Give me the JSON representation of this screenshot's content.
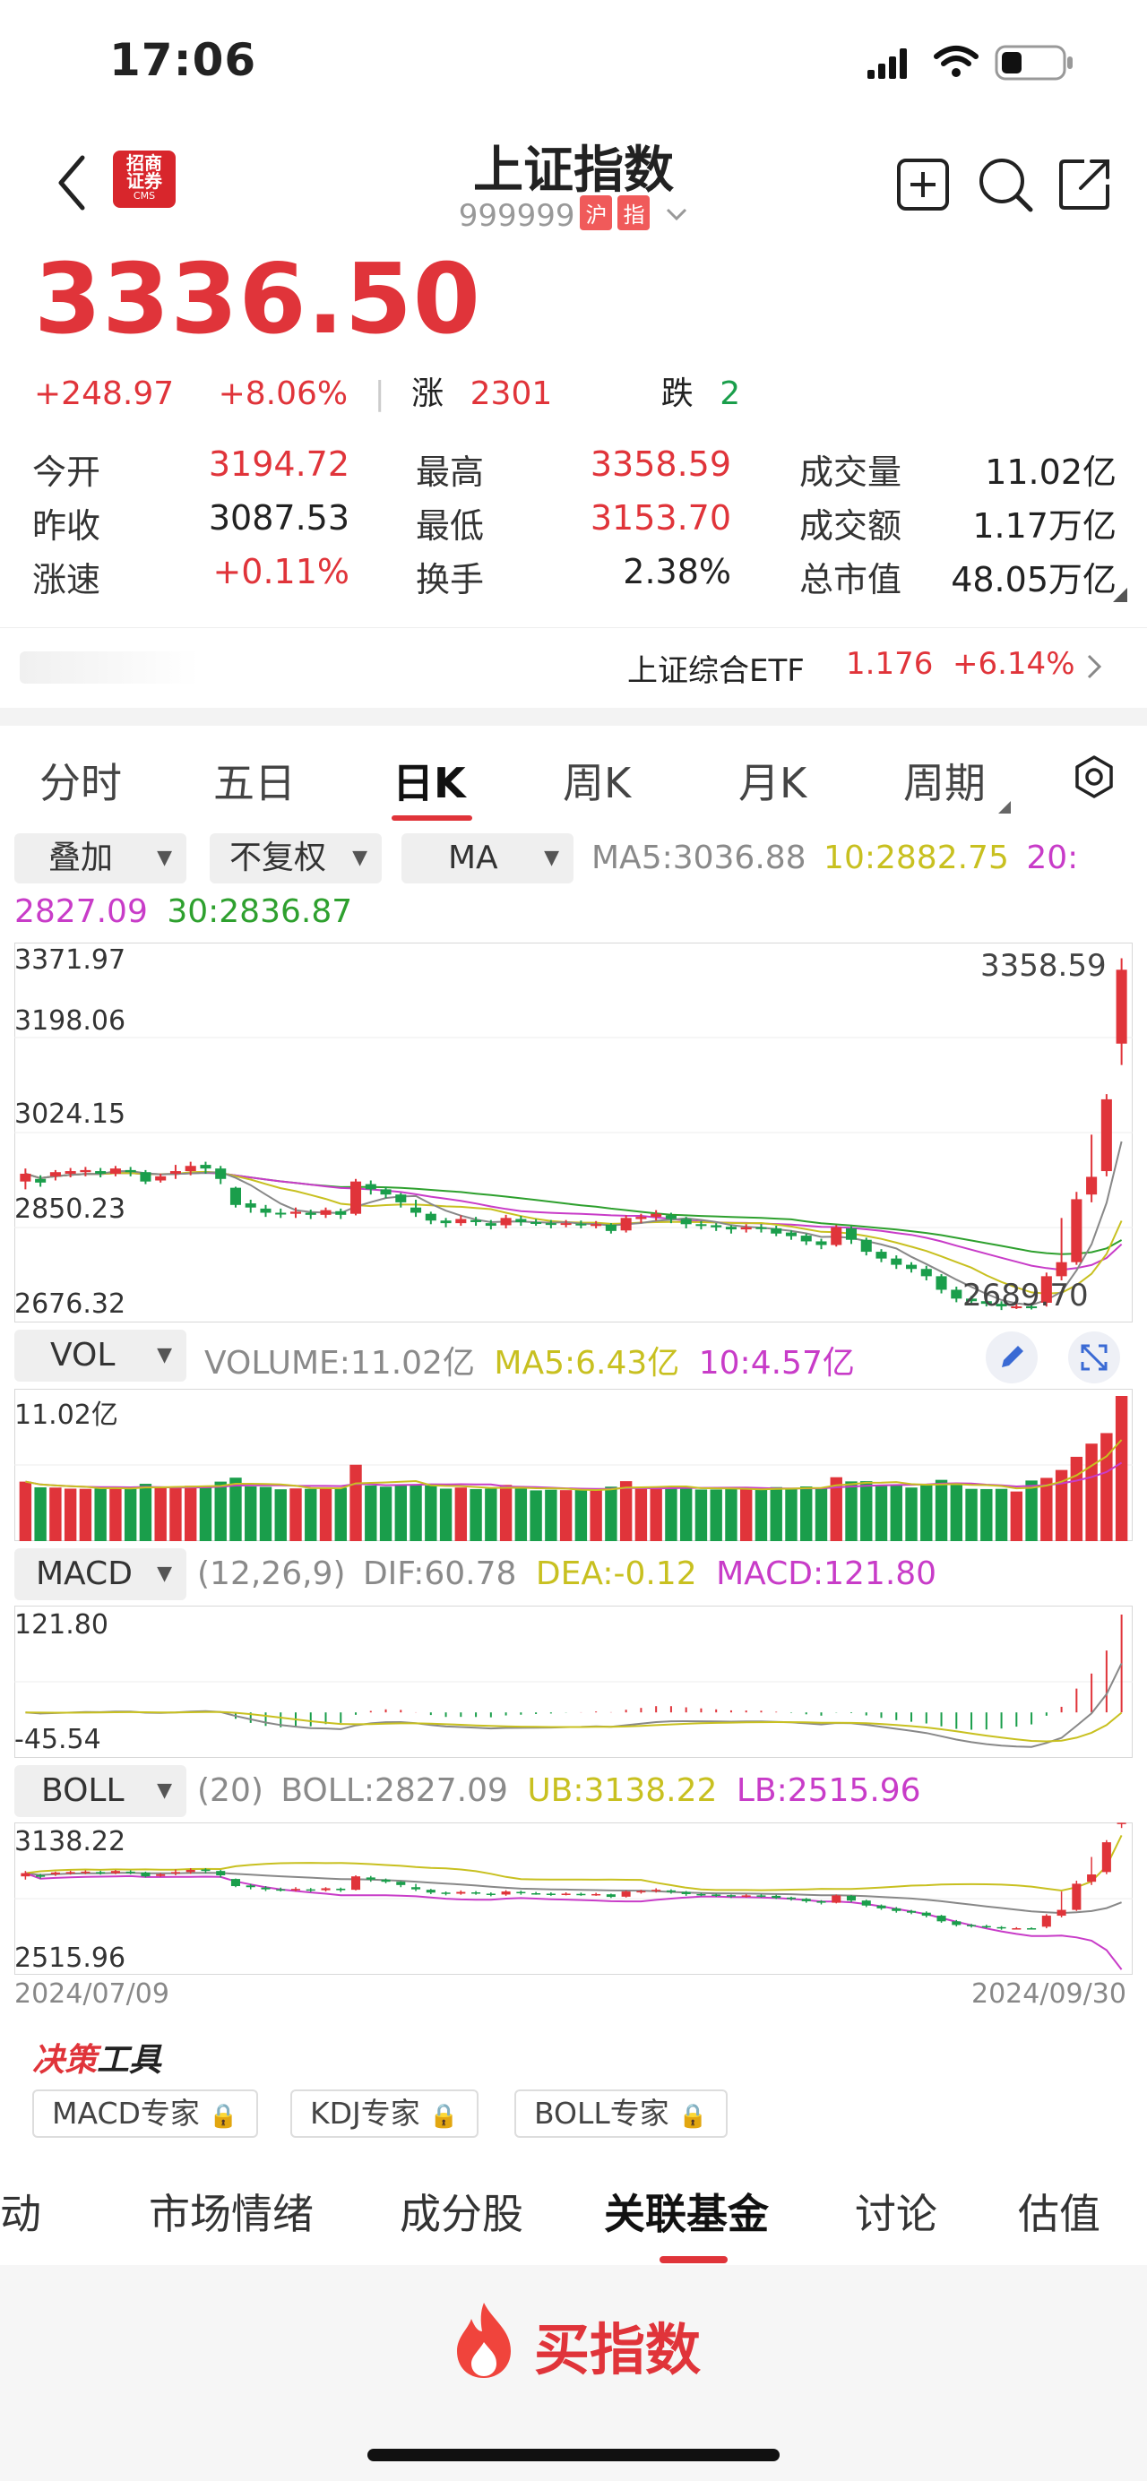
{
  "status_bar": {
    "time": "17:06"
  },
  "header": {
    "title": "上证指数",
    "code": "999999",
    "tags": [
      "沪",
      "指"
    ],
    "logo_text": [
      "招商",
      "证券",
      "CMS"
    ]
  },
  "quote": {
    "price": "3336.50",
    "change": "+248.97",
    "change_pct": "+8.06%",
    "up_label": "涨",
    "up_count": "2301",
    "down_label": "跌",
    "down_count": "2"
  },
  "stats": [
    [
      {
        "label": "今开",
        "value": "3194.72"
      },
      {
        "label": "最高",
        "value": "3358.59"
      },
      {
        "label": "成交量",
        "value": "11.02亿"
      }
    ],
    [
      {
        "label": "昨收",
        "value": "3087.53"
      },
      {
        "label": "最低",
        "value": "3153.70"
      },
      {
        "label": "成交额",
        "value": "1.17万亿"
      }
    ],
    [
      {
        "label": "涨速",
        "value": "+0.11%"
      },
      {
        "label": "换手",
        "value": "2.38%"
      },
      {
        "label": "总市值",
        "value": "48.05万亿"
      }
    ]
  ],
  "etf": {
    "name": "上证综合ETF",
    "price": "1.176",
    "pct": "+6.14%"
  },
  "period_tabs": [
    "分时",
    "五日",
    "日K",
    "周K",
    "月K",
    "周期"
  ],
  "selectors": {
    "overlay": "叠加",
    "adjust": "不复权",
    "indicator": "MA"
  },
  "ma_legend": {
    "ma5": "MA5:3036.88",
    "ma10": "10:2882.75",
    "ma20_a": "20:",
    "ma20_b": "2827.09",
    "ma30": "30:2836.87"
  },
  "kline_axis": [
    "3371.97",
    "3198.06",
    "3024.15",
    "2850.23",
    "2676.32"
  ],
  "kline_marks": {
    "high": "3358.59",
    "low": "2689.70"
  },
  "vol": {
    "selector": "VOL",
    "volume": "VOLUME:11.02亿",
    "ma5": "MA5:6.43亿",
    "ma10": "10:4.57亿",
    "axis_max": "11.02亿"
  },
  "macd": {
    "selector": "MACD",
    "params": "(12,26,9)",
    "dif": "DIF:60.78",
    "dea": "DEA:-0.12",
    "macd": "MACD:121.80",
    "axis_max": "121.80",
    "axis_min": "-45.54"
  },
  "boll": {
    "selector": "BOLL",
    "params": "(20)",
    "boll": "BOLL:2827.09",
    "ub": "UB:3138.22",
    "lb": "LB:2515.96",
    "axis_max": "3138.22",
    "axis_min": "2515.96"
  },
  "dates": {
    "start": "2024/07/09",
    "end": "2024/09/30"
  },
  "decision": {
    "title_a": "决策",
    "title_b": "工具",
    "tools": [
      "MACD专家",
      "KDJ专家",
      "BOLL专家"
    ]
  },
  "bottom_tabs": [
    "异动",
    "市场情绪",
    "成分股",
    "关联基金",
    "讨论",
    "估值"
  ],
  "buy": {
    "label": "买指数"
  },
  "colors": {
    "up": "#e0343a",
    "down": "#1a9e4b",
    "ma5": "#888888",
    "ma10": "#c8c020",
    "ma20": "#c83cc8",
    "ma30": "#2ea02e"
  },
  "chart_data": {
    "type": "candlestick",
    "x_start": "2024/07/09",
    "x_end": "2024/09/30",
    "ylim": [
      2676.32,
      3371.97
    ],
    "candles": [
      [
        2930,
        2945,
        2915,
        2955
      ],
      [
        2935,
        2928,
        2920,
        2942
      ],
      [
        2940,
        2948,
        2932,
        2952
      ],
      [
        2945,
        2950,
        2938,
        2956
      ],
      [
        2948,
        2952,
        2940,
        2958
      ],
      [
        2950,
        2945,
        2938,
        2956
      ],
      [
        2945,
        2955,
        2940,
        2960
      ],
      [
        2952,
        2948,
        2940,
        2958
      ],
      [
        2948,
        2930,
        2925,
        2952
      ],
      [
        2932,
        2940,
        2928,
        2945
      ],
      [
        2945,
        2950,
        2935,
        2962
      ],
      [
        2950,
        2960,
        2942,
        2968
      ],
      [
        2962,
        2955,
        2945,
        2968
      ],
      [
        2955,
        2935,
        2925,
        2960
      ],
      [
        2918,
        2885,
        2880,
        2920
      ],
      [
        2888,
        2880,
        2870,
        2895
      ],
      [
        2878,
        2870,
        2862,
        2885
      ],
      [
        2870,
        2868,
        2860,
        2878
      ],
      [
        2868,
        2872,
        2860,
        2880
      ],
      [
        2870,
        2866,
        2858,
        2876
      ],
      [
        2866,
        2875,
        2860,
        2880
      ],
      [
        2873,
        2866,
        2858,
        2878
      ],
      [
        2868,
        2930,
        2865,
        2935
      ],
      [
        2925,
        2915,
        2905,
        2932
      ],
      [
        2915,
        2905,
        2898,
        2920
      ],
      [
        2905,
        2890,
        2880,
        2908
      ],
      [
        2880,
        2870,
        2862,
        2895
      ],
      [
        2868,
        2855,
        2848,
        2872
      ],
      [
        2855,
        2850,
        2842,
        2860
      ],
      [
        2850,
        2858,
        2845,
        2865
      ],
      [
        2856,
        2852,
        2845,
        2862
      ],
      [
        2850,
        2845,
        2838,
        2856
      ],
      [
        2846,
        2860,
        2840,
        2866
      ],
      [
        2858,
        2852,
        2845,
        2864
      ],
      [
        2852,
        2850,
        2845,
        2858
      ],
      [
        2850,
        2848,
        2840,
        2856
      ],
      [
        2848,
        2850,
        2842,
        2856
      ],
      [
        2849,
        2846,
        2840,
        2855
      ],
      [
        2846,
        2848,
        2840,
        2854
      ],
      [
        2847,
        2835,
        2830,
        2850
      ],
      [
        2836,
        2860,
        2832,
        2865
      ],
      [
        2858,
        2862,
        2850,
        2868
      ],
      [
        2862,
        2868,
        2855,
        2875
      ],
      [
        2865,
        2858,
        2850,
        2870
      ],
      [
        2858,
        2848,
        2840,
        2862
      ],
      [
        2848,
        2845,
        2838,
        2854
      ],
      [
        2846,
        2842,
        2835,
        2850
      ],
      [
        2843,
        2838,
        2830,
        2846
      ],
      [
        2838,
        2842,
        2832,
        2848
      ],
      [
        2842,
        2840,
        2832,
        2848
      ],
      [
        2840,
        2830,
        2825,
        2845
      ],
      [
        2832,
        2825,
        2818,
        2836
      ],
      [
        2826,
        2815,
        2808,
        2830
      ],
      [
        2815,
        2808,
        2800,
        2820
      ],
      [
        2808,
        2842,
        2805,
        2846
      ],
      [
        2840,
        2818,
        2810,
        2844
      ],
      [
        2818,
        2795,
        2788,
        2822
      ],
      [
        2795,
        2782,
        2775,
        2800
      ],
      [
        2782,
        2770,
        2762,
        2788
      ],
      [
        2770,
        2762,
        2755,
        2775
      ],
      [
        2762,
        2748,
        2740,
        2768
      ],
      [
        2748,
        2722,
        2715,
        2752
      ],
      [
        2722,
        2705,
        2698,
        2728
      ],
      [
        2705,
        2700,
        2693,
        2710
      ],
      [
        2700,
        2695,
        2690,
        2706
      ],
      [
        2695,
        2690,
        2683,
        2700
      ],
      [
        2690,
        2690,
        2685,
        2695
      ],
      [
        2690,
        2688,
        2684,
        2694
      ],
      [
        2697,
        2748,
        2689.7,
        2755
      ],
      [
        2748,
        2775,
        2740,
        2860
      ],
      [
        2775,
        2896,
        2770,
        2910
      ],
      [
        2905,
        2939,
        2890,
        3020
      ],
      [
        2950,
        3088,
        2940,
        3098
      ],
      [
        3195,
        3337,
        3154,
        3359
      ]
    ],
    "volume_max": 11.02
  }
}
